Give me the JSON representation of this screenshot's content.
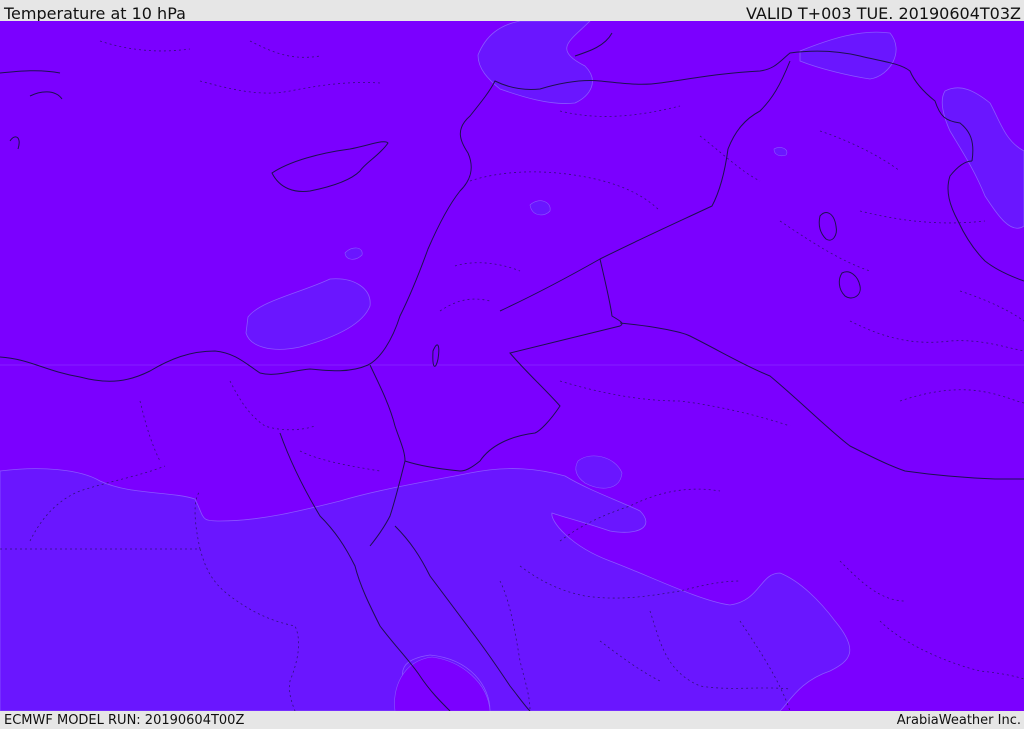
{
  "header": {
    "title": "Temperature at 10 hPa",
    "valid_time": "VALID T+003 TUE. 20190604T03Z"
  },
  "footer": {
    "model_run": "ECMWF MODEL RUN: 20190604T00Z",
    "credit": "ArabiaWeather Inc."
  },
  "colors": {
    "field_primary": "#7b00ff",
    "field_secondary": "#6a16ff",
    "boundary": "#1e1050",
    "panel": "#e6e6e6"
  }
}
